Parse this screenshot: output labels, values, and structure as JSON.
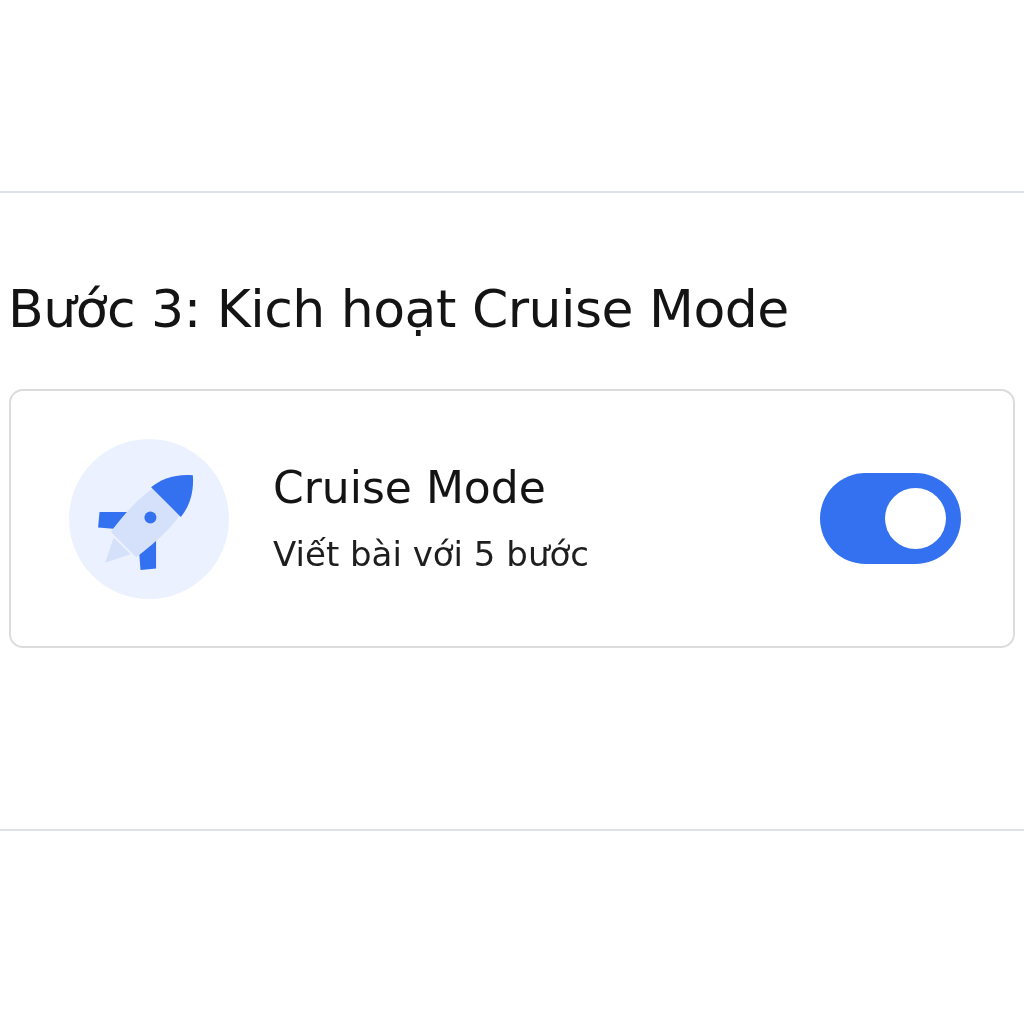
{
  "heading": "Bước 3: Kich hoạt Cruise Mode",
  "setting": {
    "title": "Cruise Mode",
    "description": "Viết bài với 5 bước",
    "on": true
  }
}
